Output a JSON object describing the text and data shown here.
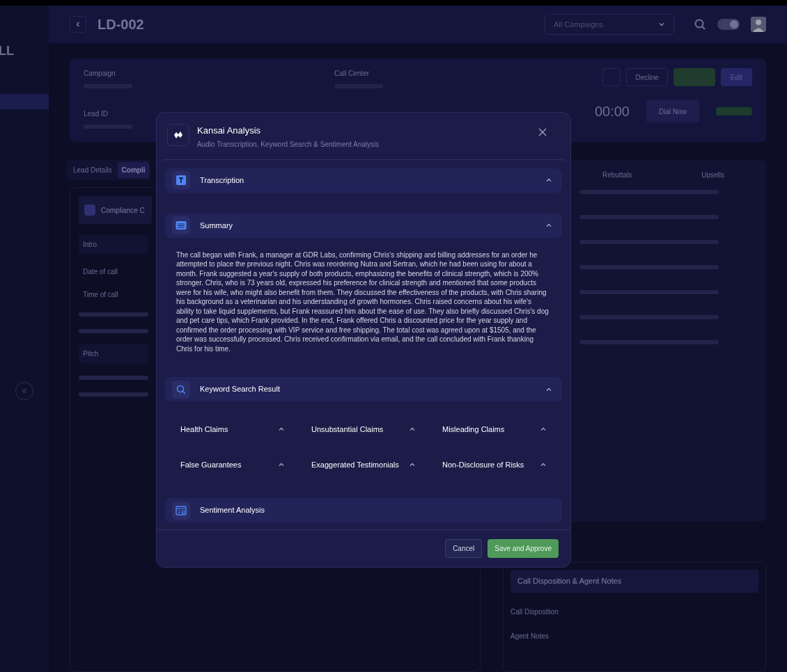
{
  "background": {
    "logo": "LL",
    "title": "LD-002",
    "campaign_filter": "All Campaigns",
    "theme_toggle": {
      "on": true
    },
    "compliance_card": "Compliance C",
    "info_labels": [
      "Campaign",
      "Call Center",
      "Lead ID"
    ],
    "actions": [
      "Decline",
      "Edit"
    ],
    "timer": "00:00",
    "dial_button": "Dial Now",
    "tabs": [
      {
        "label": "Lead Details",
        "selected": false
      },
      {
        "label": "Compli",
        "selected": true
      }
    ],
    "script_tabs": [
      "Rebuttals",
      "Upsells"
    ],
    "checklist_sections": [
      {
        "title": "Intro",
        "rows": [
          "Date of call",
          "Time of call"
        ]
      },
      {
        "title": "Pitch"
      }
    ],
    "notes_panel": {
      "title": "Call Disposition & Agent Notes",
      "labels": [
        "Call Disposition",
        "Agent Notes"
      ]
    }
  },
  "modal": {
    "title": "Kansai Analysis",
    "subtitle": "Audio Transcription, Keyword Search & Sentiment Analysis",
    "sections": [
      {
        "kind": "transcription",
        "title": "Transcription",
        "expanded": true
      },
      {
        "kind": "summary",
        "title": "Summary",
        "expanded": true,
        "text": "The call began with Frank, a manager at GDR Labs, confirming Chris's shipping and billing addresses for an order he attempted to place the previous night. Chris was reordering Nutra and Sertran, which he had been using for about a month. Frank suggested a year's supply of both products, emphasizing the benefits of clinical strength, which is 200% stronger. Chris, who is 73 years old, expressed his preference for clinical strength and mentioned that some products were for his wife, who might also benefit from them. They discussed the effectiveness of the products, with Chris sharing his background as a veterinarian and his understanding of growth hormones. Chris raised concerns about his wife's ability to take liquid supplements, but Frank reassured him about the ease of use. They also briefly discussed Chris's dog and pet care tips, which Frank provided. In the end, Frank offered Chris a discounted price for the year supply and confirmed the order processing with VIP service and free shipping. The total cost was agreed upon at $1505, and the order was successfully processed. Chris received confirmation via email, and the call concluded with Frank thanking Chris for his time."
      },
      {
        "kind": "keywords",
        "title": "Keyword Search Result",
        "expanded": true,
        "keywords": [
          {
            "label": "Health Claims",
            "expanded": true
          },
          {
            "label": "Unsubstantial Claims",
            "expanded": true
          },
          {
            "label": "Misleading Claims",
            "expanded": true
          },
          {
            "label": "False Guarantees",
            "expanded": true
          },
          {
            "label": "Exaggerated Testimonials",
            "expanded": true
          },
          {
            "label": "Non-Disclosure of Risks",
            "expanded": true
          }
        ]
      },
      {
        "kind": "sentiment",
        "title": "Sentiment Analysis"
      }
    ],
    "cancel_button": "Cancel",
    "save_button": "Save and Approve"
  }
}
